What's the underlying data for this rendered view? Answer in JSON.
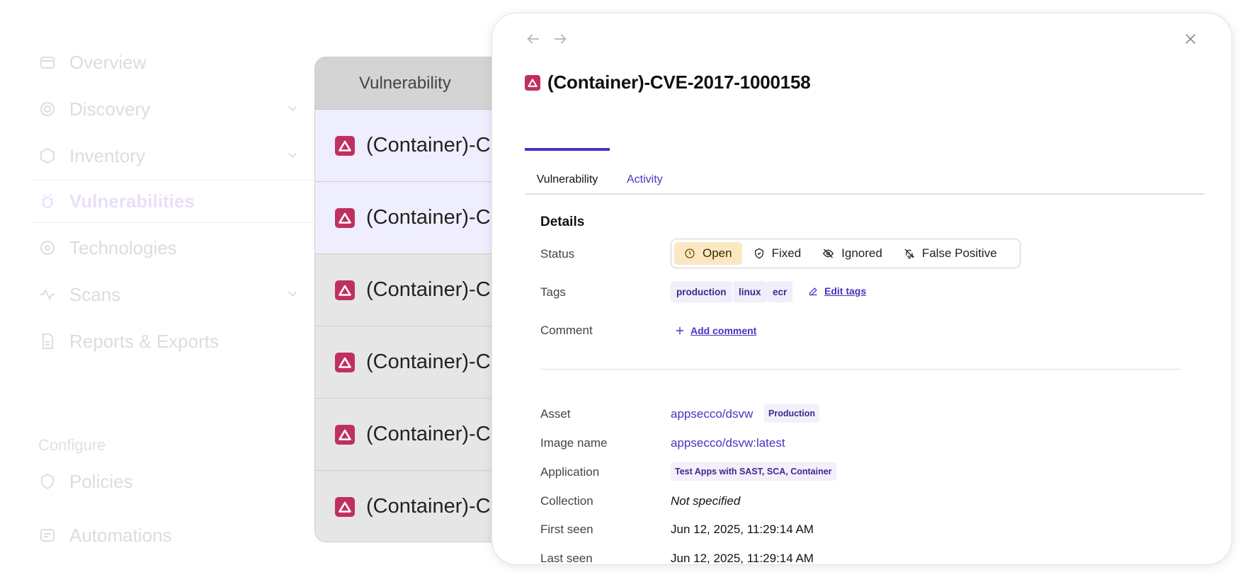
{
  "sidebar": {
    "items": [
      {
        "label": "Overview",
        "icon": "home-icon"
      },
      {
        "label": "Discovery",
        "icon": "radar-icon",
        "expandable": true
      },
      {
        "label": "Inventory",
        "icon": "cube-icon",
        "expandable": true
      },
      {
        "label": "Vulnerabilities",
        "icon": "bug-icon",
        "active": true
      },
      {
        "label": "Technologies",
        "icon": "gear-icon"
      },
      {
        "label": "Scans",
        "icon": "wave-icon",
        "expandable": true
      },
      {
        "label": "Reports & Exports",
        "icon": "report-icon"
      }
    ],
    "configure_label": "Configure",
    "configure_items": [
      {
        "label": "Policies",
        "icon": "shield-icon"
      },
      {
        "label": "Automations",
        "icon": "automation-icon"
      }
    ]
  },
  "table": {
    "column_header": "Vulnerability",
    "rows": [
      "(Container)-C",
      "(Container)-C",
      "(Container)-C",
      "(Container)-C",
      "(Container)-C",
      "(Container)-C"
    ],
    "severity_color": "#c0305f"
  },
  "panel": {
    "title": "(Container)-CVE-2017-1000158",
    "tabs": {
      "vulnerability": "Vulnerability",
      "activity": "Activity"
    },
    "details_title": "Details",
    "labels": {
      "status": "Status",
      "tags": "Tags",
      "comment": "Comment",
      "asset": "Asset",
      "image_name": "Image name",
      "application": "Application",
      "collection": "Collection",
      "first_seen": "First seen",
      "last_seen": "Last seen"
    },
    "status_options": {
      "open": "Open",
      "fixed": "Fixed",
      "ignored": "Ignored",
      "false_positive": "False Positive"
    },
    "selected_status": "Open",
    "tags": {
      "t1": "production",
      "t2": "linux",
      "t3": "ecr"
    },
    "edit_tags": "Edit tags",
    "add_comment": "Add comment",
    "values": {
      "asset": "appsecco/dsvw",
      "asset_env": "Production",
      "image_name": "appsecco/dsvw:latest",
      "application": "Test Apps with SAST, SCA, Container",
      "collection": "Not specified",
      "first_seen": "Jun 12, 2025, 11:29:14 AM",
      "last_seen": "Jun 12, 2025, 11:29:14 AM"
    },
    "accent_color": "#4a32c0",
    "open_status_color": "#fbe8c3"
  }
}
